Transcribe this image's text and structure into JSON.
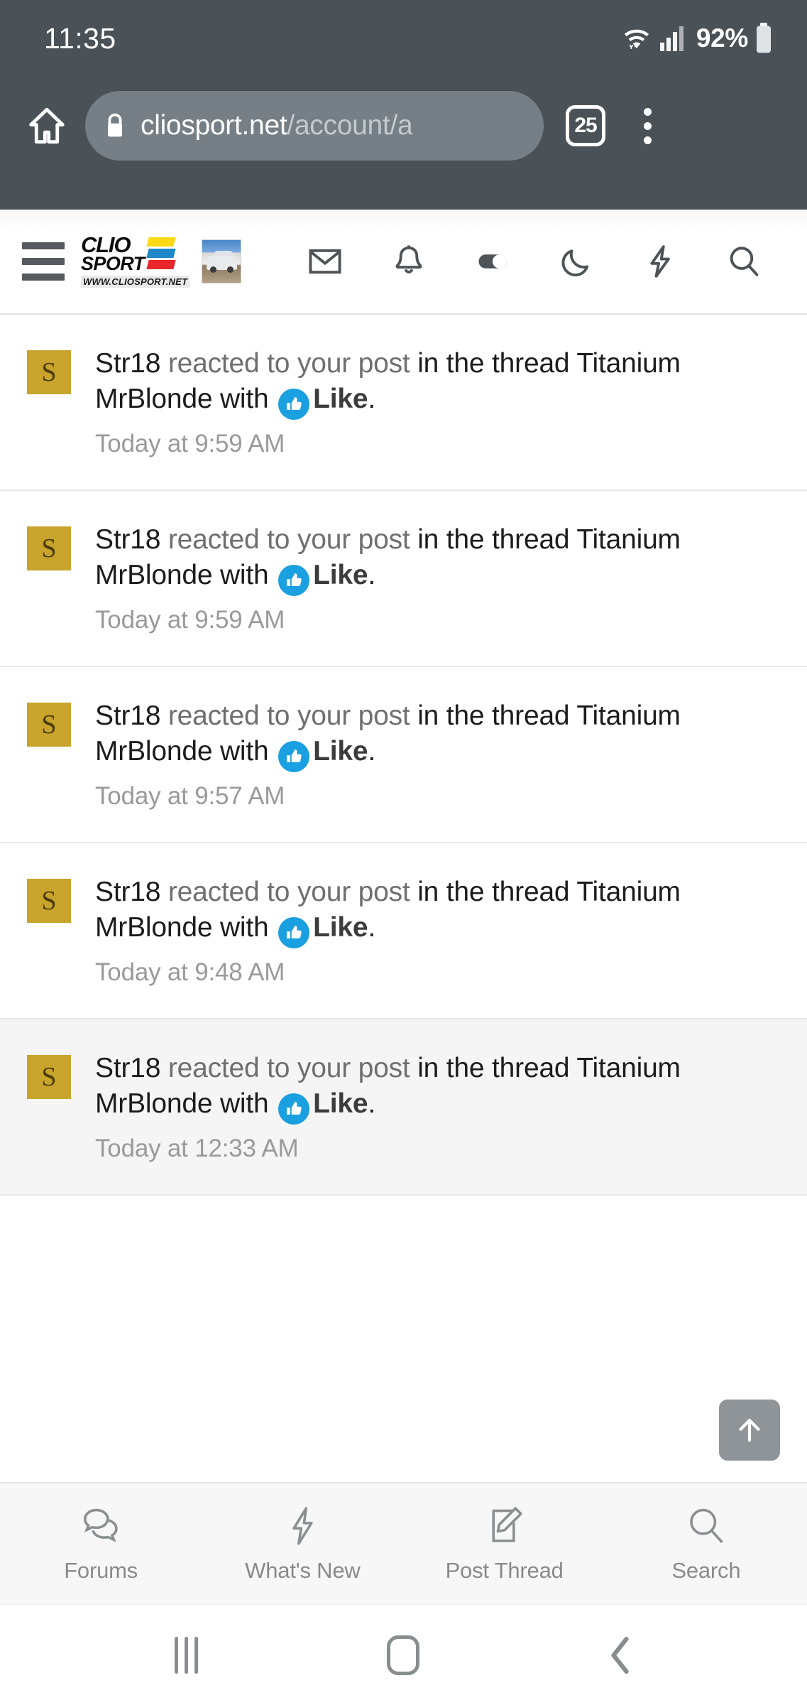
{
  "status_bar": {
    "clock": "11:35",
    "battery_percent": "92%",
    "wifi_icon": "wifi-icon",
    "signal_icon": "cellular-signal-icon",
    "battery_icon": "battery-icon"
  },
  "browser": {
    "home_icon": "home-icon",
    "lock_icon": "lock-icon",
    "url_domain": "cliosport.net",
    "url_path": "/account/a",
    "tab_count": "25",
    "menu_icon": "overflow-menu-icon"
  },
  "site_header": {
    "menu_icon": "hamburger-menu-icon",
    "brand_line1": "CLIO",
    "brand_line2": "SPORT",
    "brand_url": "WWW.CLIOSPORT.NET",
    "avatar_icon": "user-avatar-car-photo",
    "icons": [
      {
        "name": "inbox-icon",
        "label": "Inbox"
      },
      {
        "name": "alerts-bell-icon",
        "label": "Alerts"
      },
      {
        "name": "contrast-toggle-icon",
        "label": "Contrast"
      },
      {
        "name": "dark-mode-moon-icon",
        "label": "Dark mode"
      },
      {
        "name": "whats-new-bolt-icon",
        "label": "What's New"
      },
      {
        "name": "search-icon",
        "label": "Search"
      }
    ]
  },
  "notifications": [
    {
      "avatar_initial": "S",
      "user": "Str18",
      "action": " reacted to ",
      "target": "your post",
      "context": " in the thread Titanium MrBlonde with ",
      "reaction": "Like",
      "suffix": ".",
      "time": "Today at 9:59 AM",
      "unread": false
    },
    {
      "avatar_initial": "S",
      "user": "Str18",
      "action": " reacted to ",
      "target": "your post",
      "context": " in the thread Titanium MrBlonde with ",
      "reaction": "Like",
      "suffix": ".",
      "time": "Today at 9:59 AM",
      "unread": false
    },
    {
      "avatar_initial": "S",
      "user": "Str18",
      "action": " reacted to ",
      "target": "your post",
      "context": " in the thread Titanium MrBlonde with ",
      "reaction": "Like",
      "suffix": ".",
      "time": "Today at 9:57 AM",
      "unread": false
    },
    {
      "avatar_initial": "S",
      "user": "Str18",
      "action": " reacted to ",
      "target": "your post",
      "context": " in the thread Titanium MrBlonde with ",
      "reaction": "Like",
      "suffix": ".",
      "time": "Today at 9:48 AM",
      "unread": false
    },
    {
      "avatar_initial": "S",
      "user": "Str18",
      "action": " reacted to ",
      "target": "your post",
      "context": " in the thread Titanium MrBlonde with ",
      "reaction": "Like",
      "suffix": ".",
      "time": "Today at 12:33 AM",
      "unread": true
    }
  ],
  "scroll_top_button": {
    "icon": "arrow-up-icon"
  },
  "bottom_tabs": [
    {
      "label": "Forums",
      "icon": "forums-chat-bubbles-icon"
    },
    {
      "label": "What's New",
      "icon": "bolt-icon"
    },
    {
      "label": "Post Thread",
      "icon": "compose-pencil-icon"
    },
    {
      "label": "Search",
      "icon": "search-icon"
    }
  ],
  "android_nav": {
    "recents_icon": "recents-icon",
    "home_icon": "home-square-icon",
    "back_icon": "back-chevron-icon"
  },
  "colors": {
    "chrome_bg": "#4a5257",
    "url_pill": "#767f85",
    "avatar_gold": "#c8a42c",
    "reaction_blue": "#1a9fe0",
    "brand_yellow": "#fbd914",
    "brand_blue": "#1d87c8",
    "brand_red": "#e8262c",
    "unread_bg": "#f5f5f5"
  }
}
